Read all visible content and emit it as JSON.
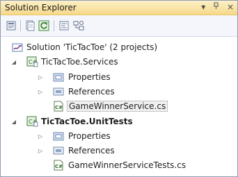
{
  "window": {
    "title": "Solution Explorer",
    "buttons": {
      "dropdown": "▾",
      "pin": "ꟼ",
      "close": "×"
    }
  },
  "toolbar": {
    "buttons": [
      "properties-icon",
      "show-all-files-icon",
      "refresh-icon",
      "view-code-icon",
      "class-diagram-icon"
    ]
  },
  "tree": {
    "solution": {
      "label": "Solution 'TicTacToe' (2 projects)"
    },
    "projects": [
      {
        "label": "TicTacToe.Services",
        "bold": false,
        "children": [
          {
            "label": "Properties",
            "type": "folder"
          },
          {
            "label": "References",
            "type": "references"
          },
          {
            "label": "GameWinnerService.cs",
            "type": "cs-file",
            "selected": true
          }
        ]
      },
      {
        "label": "TicTacToe.UnitTests",
        "bold": true,
        "children": [
          {
            "label": "Properties",
            "type": "folder"
          },
          {
            "label": "References",
            "type": "references"
          },
          {
            "label": "GameWinnerServiceTests.cs",
            "type": "cs-file",
            "selected": false
          }
        ]
      }
    ]
  }
}
